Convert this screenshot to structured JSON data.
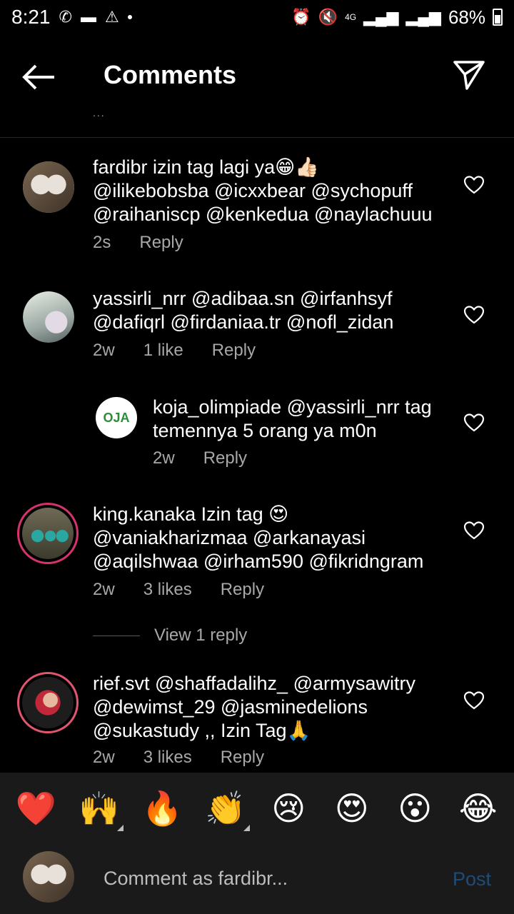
{
  "status_bar": {
    "time": "8:21",
    "network": "4G",
    "battery": "68%"
  },
  "header": {
    "title": "Comments",
    "partial_text": "..."
  },
  "comments": [
    {
      "username": "fardibr",
      "text": "izin tag lagi ya😁👍🏻",
      "line2": "@ilikebobsba @icxxbear @sychopuff",
      "line3": "@raihaniscp @kenkedua @naylachuuu",
      "time": "2s",
      "reply": "Reply"
    },
    {
      "username": "yassirli_nrr",
      "text": "@adibaa.sn @irfanhsyf",
      "line2": "@dafiqrl @firdaniaa.tr @nofl_zidan",
      "time": "2w",
      "likes": "1 like",
      "reply": "Reply"
    },
    {
      "username": "koja_olimpiade",
      "text": "@yassirli_nrr tag",
      "line2": "temennya 5 orang ya m0n",
      "time": "2w",
      "reply": "Reply",
      "logo_text": "OJA"
    },
    {
      "username": "king.kanaka",
      "text": "Izin tag 😍",
      "line2": "@vaniakharizmaa @arkanayasi",
      "line3": "@aqilshwaa @irham590 @fikridngram",
      "time": "2w",
      "likes": "3 likes",
      "reply": "Reply"
    },
    {
      "username": "rief.svt",
      "text": "@shaffadalihz_ @armysawitry",
      "line2": "@dewimst_29 @jasminedelions",
      "line3": "@sukastudy ,, Izin Tag🙏",
      "time": "2w",
      "likes": "3 likes",
      "reply": "Reply"
    }
  ],
  "view_reply": "View 1 reply",
  "emoji_bar": [
    "❤️",
    "🙌",
    "🔥",
    "👏",
    "😢",
    "😍",
    "😮",
    "😂"
  ],
  "input": {
    "placeholder": "Comment as fardibr...",
    "post_label": "Post"
  },
  "colors": {
    "background": "#000000",
    "meta_text": "#a8a8a8",
    "post_disabled": "#1e4c7a",
    "story_ring": "#e1306c"
  }
}
